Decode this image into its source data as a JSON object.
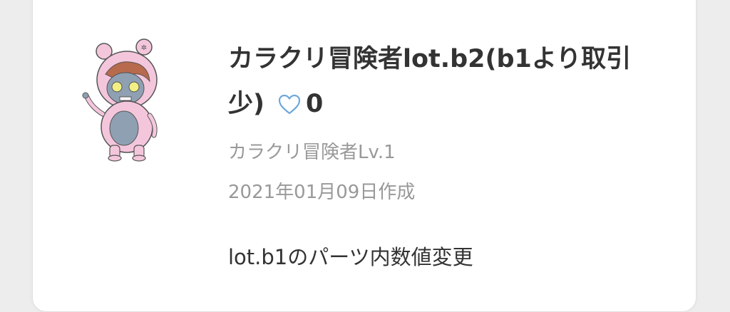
{
  "post": {
    "title": "カラクリ冒険者lot.b2(b1より取引少)",
    "like_icon": "heart-outline-icon",
    "like_color": "#6fa8dc",
    "like_count": "0",
    "author": "カラクリ冒険者Lv.1",
    "created": "2021年01月09日作成",
    "description": "lot.b1のパーツ内数値変更"
  },
  "avatar": {
    "icon": "character-avatar-icon",
    "colors": {
      "suit": "#f4c6dc",
      "hair": "#b86a4c",
      "face": "#8fa0b3",
      "eyes": "#f2ef84"
    }
  }
}
